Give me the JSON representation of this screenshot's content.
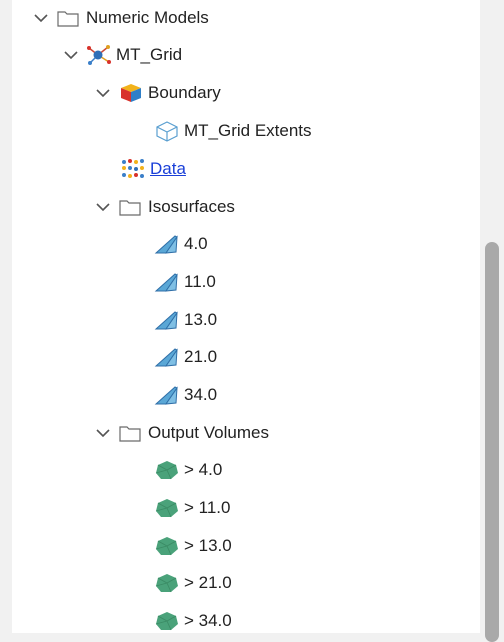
{
  "tree": {
    "numeric_models": "Numeric Models",
    "mt_grid": "MT_Grid",
    "boundary": "Boundary",
    "mt_grid_extents": "MT_Grid Extents",
    "data": "Data",
    "isosurfaces": {
      "label": "Isosurfaces",
      "items": [
        "4.0",
        "11.0",
        "13.0",
        "21.0",
        "34.0"
      ]
    },
    "output_volumes": {
      "label": "Output Volumes",
      "items": [
        "> 4.0",
        "> 11.0",
        "> 13.0",
        "> 21.0",
        "> 34.0"
      ]
    }
  },
  "colors": {
    "link": "#1a3fd8",
    "isosurface": "#5aa7d6",
    "volume": "#4aa27a",
    "boundary_red": "#d8322b",
    "boundary_yellow": "#f2b21b",
    "boundary_blue": "#2f7fc8"
  },
  "icons": {
    "folder": "folder-icon",
    "grid": "grid-model-icon",
    "boundary": "boundary-box-icon",
    "extents": "wireframe-cube-icon",
    "data": "data-points-icon",
    "isosurface": "isosurface-icon",
    "volume": "volume-icon"
  }
}
